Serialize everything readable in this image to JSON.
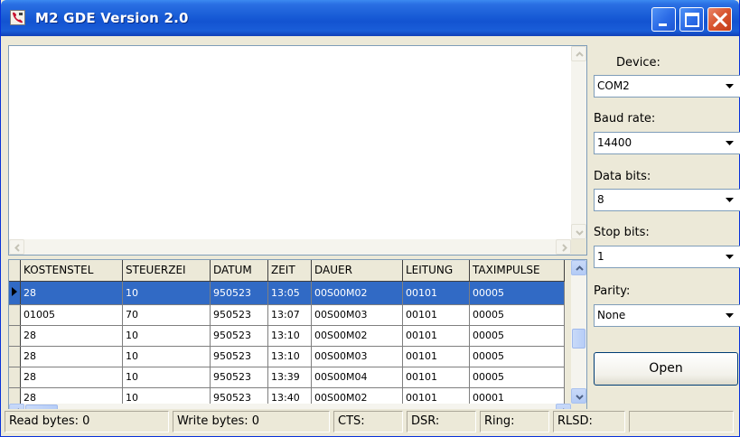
{
  "window": {
    "title": "M2 GDE Version 2.0",
    "icon": "phone-app-icon",
    "controls": [
      "minimize-icon",
      "maximize-icon",
      "close-icon"
    ]
  },
  "settings": {
    "device_label": "Device:",
    "device_value": "COM2",
    "baud_label": "Baud rate:",
    "baud_value": "14400",
    "databits_label": "Data bits:",
    "databits_value": "8",
    "stopbits_label": "Stop bits:",
    "stopbits_value": "1",
    "parity_label": "Parity:",
    "parity_value": "None",
    "open_label": "Open"
  },
  "grid": {
    "columns": [
      "KOSTENSTEL",
      "STEUERZEI",
      "DATUM",
      "ZEIT",
      "DAUER",
      "LEITUNG",
      "TAXIMPULSE"
    ],
    "rows": [
      [
        "28",
        "10",
        "950523",
        "13:05",
        "00S00M02",
        "00101",
        "00005"
      ],
      [
        "01005",
        "70",
        "950523",
        "13:07",
        "00S00M03",
        "00101",
        "00005"
      ],
      [
        "28",
        "10",
        "950523",
        "13:10",
        "00S00M02",
        "00101",
        "00005"
      ],
      [
        "28",
        "10",
        "950523",
        "13:10",
        "00S00M03",
        "00101",
        "00005"
      ],
      [
        "28",
        "10",
        "950523",
        "13:39",
        "00S00M04",
        "00101",
        "00005"
      ],
      [
        "28",
        "10",
        "950523",
        "13:40",
        "00S00M02",
        "00101",
        "00001"
      ]
    ],
    "selected_row": 0
  },
  "statusbar": {
    "read_bytes": "Read bytes: 0",
    "write_bytes": "Write bytes: 0",
    "cts": "CTS:",
    "dsr": "DSR:",
    "ring": "Ring:",
    "rlsd": "RLSD:"
  },
  "colors": {
    "title_blue": "#1353d1",
    "selection": "#316ac5",
    "face": "#ece9d8",
    "close_red": "#d8542e"
  }
}
